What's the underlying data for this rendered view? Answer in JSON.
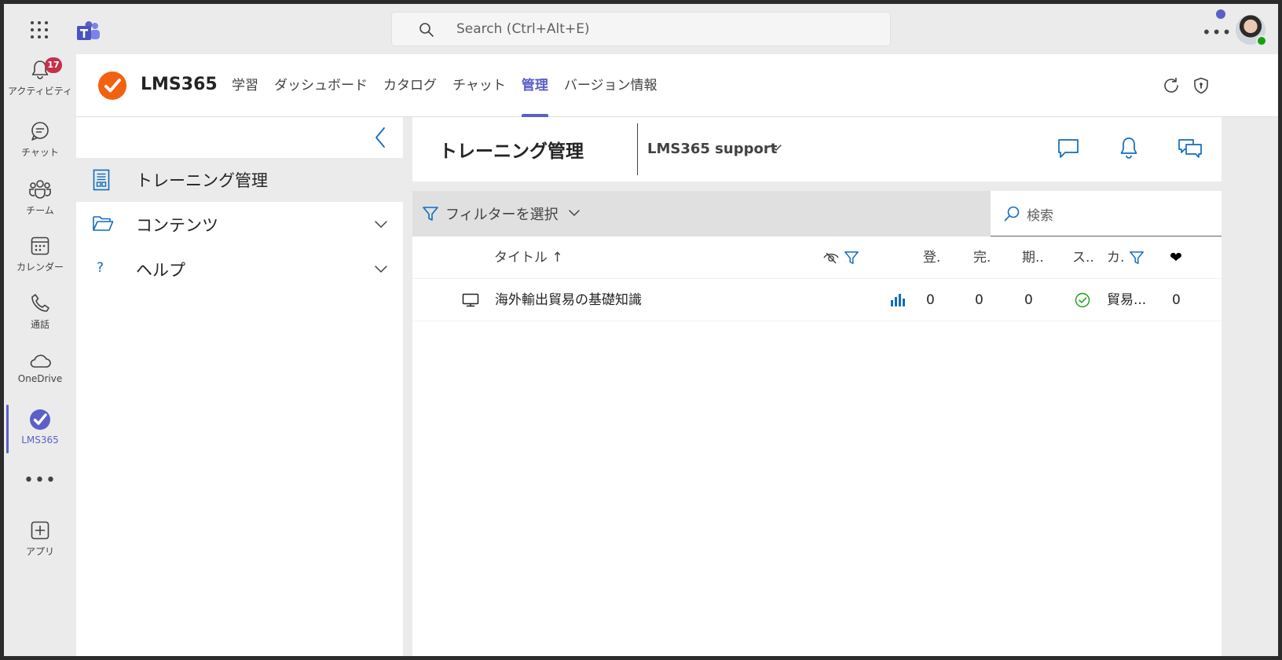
{
  "search": {
    "placeholder": "Search (Ctrl+Alt+E)"
  },
  "rail": {
    "items": [
      {
        "label": "アクティビティ",
        "icon": "bell-icon",
        "badge": "17"
      },
      {
        "label": "チャット",
        "icon": "chat-icon"
      },
      {
        "label": "チーム",
        "icon": "teams-icon"
      },
      {
        "label": "カレンダー",
        "icon": "calendar-icon"
      },
      {
        "label": "通話",
        "icon": "phone-icon"
      },
      {
        "label": "OneDrive",
        "icon": "cloud-icon"
      },
      {
        "label": "LMS365",
        "icon": "lms365-icon",
        "active": true
      },
      {
        "label": "アプリ",
        "icon": "add-app-icon"
      }
    ],
    "more": "•••"
  },
  "app": {
    "name": "LMS365",
    "tabs": [
      {
        "label": "学習"
      },
      {
        "label": "ダッシュボード"
      },
      {
        "label": "カタログ"
      },
      {
        "label": "チャット"
      },
      {
        "label": "管理",
        "active": true
      },
      {
        "label": "バージョン情報"
      }
    ]
  },
  "nav": {
    "items": [
      {
        "label": "トレーニング管理",
        "icon": "document-icon"
      },
      {
        "label": "コンテンツ",
        "icon": "folder-icon"
      },
      {
        "label": "ヘルプ",
        "icon": "question-icon"
      }
    ]
  },
  "main": {
    "title": "トレーニング管理",
    "dropdown": "LMS365 support",
    "filter_label": "フィルターを選択",
    "search_placeholder": "検索",
    "columns": {
      "title": "タイトル ↑",
      "enrolled": "登.",
      "completed": "完.",
      "period": "期..",
      "status": "ス..",
      "category": "カ.",
      "likes": "❤"
    },
    "rows": [
      {
        "title": "海外輸出貿易の基礎知識",
        "enrolled": "0",
        "completed": "0",
        "period": "0",
        "category": "貿易...",
        "likes": "0"
      }
    ]
  },
  "colors": {
    "accent": "#5b5fc7",
    "brand": "#f2610f",
    "link": "#0f6cbd",
    "badge": "#c4314b",
    "success": "#13a10e"
  }
}
